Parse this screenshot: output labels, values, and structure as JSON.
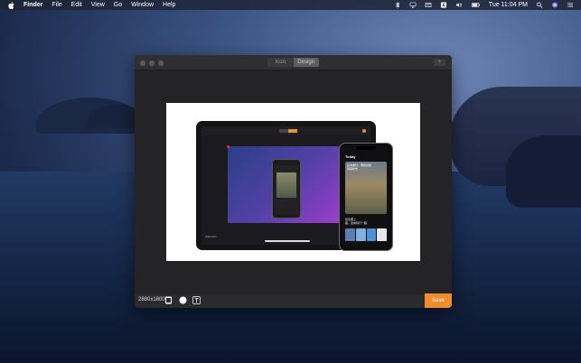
{
  "menubar": {
    "app": "Finder",
    "items": [
      "File",
      "Edit",
      "View",
      "Go",
      "Window",
      "Help"
    ],
    "clock": "Tue 11:04 PM",
    "status_icons": [
      "bluetooth-icon",
      "airplay-icon",
      "keyboard-icon",
      "text-input-icon",
      "volume-icon",
      "battery-icon",
      "search-icon",
      "siri-icon",
      "notification-center-icon"
    ]
  },
  "window": {
    "tabs": [
      {
        "label": "Icon",
        "active": false
      },
      {
        "label": "Design",
        "active": true
      }
    ],
    "add_button": "+",
    "dimensions": "2880x1800",
    "save_label": "Save",
    "accent": "#f08c2c"
  },
  "mockup": {
    "ipad_caption": "2880x1800",
    "iphone_header": "Today",
    "iphone_title_lines": [
      "這本旅行，哪些冒險",
      "值得你去"
    ],
    "iphone_sub_lines": [
      "別急著上",
      "路，走向同行一程"
    ]
  }
}
